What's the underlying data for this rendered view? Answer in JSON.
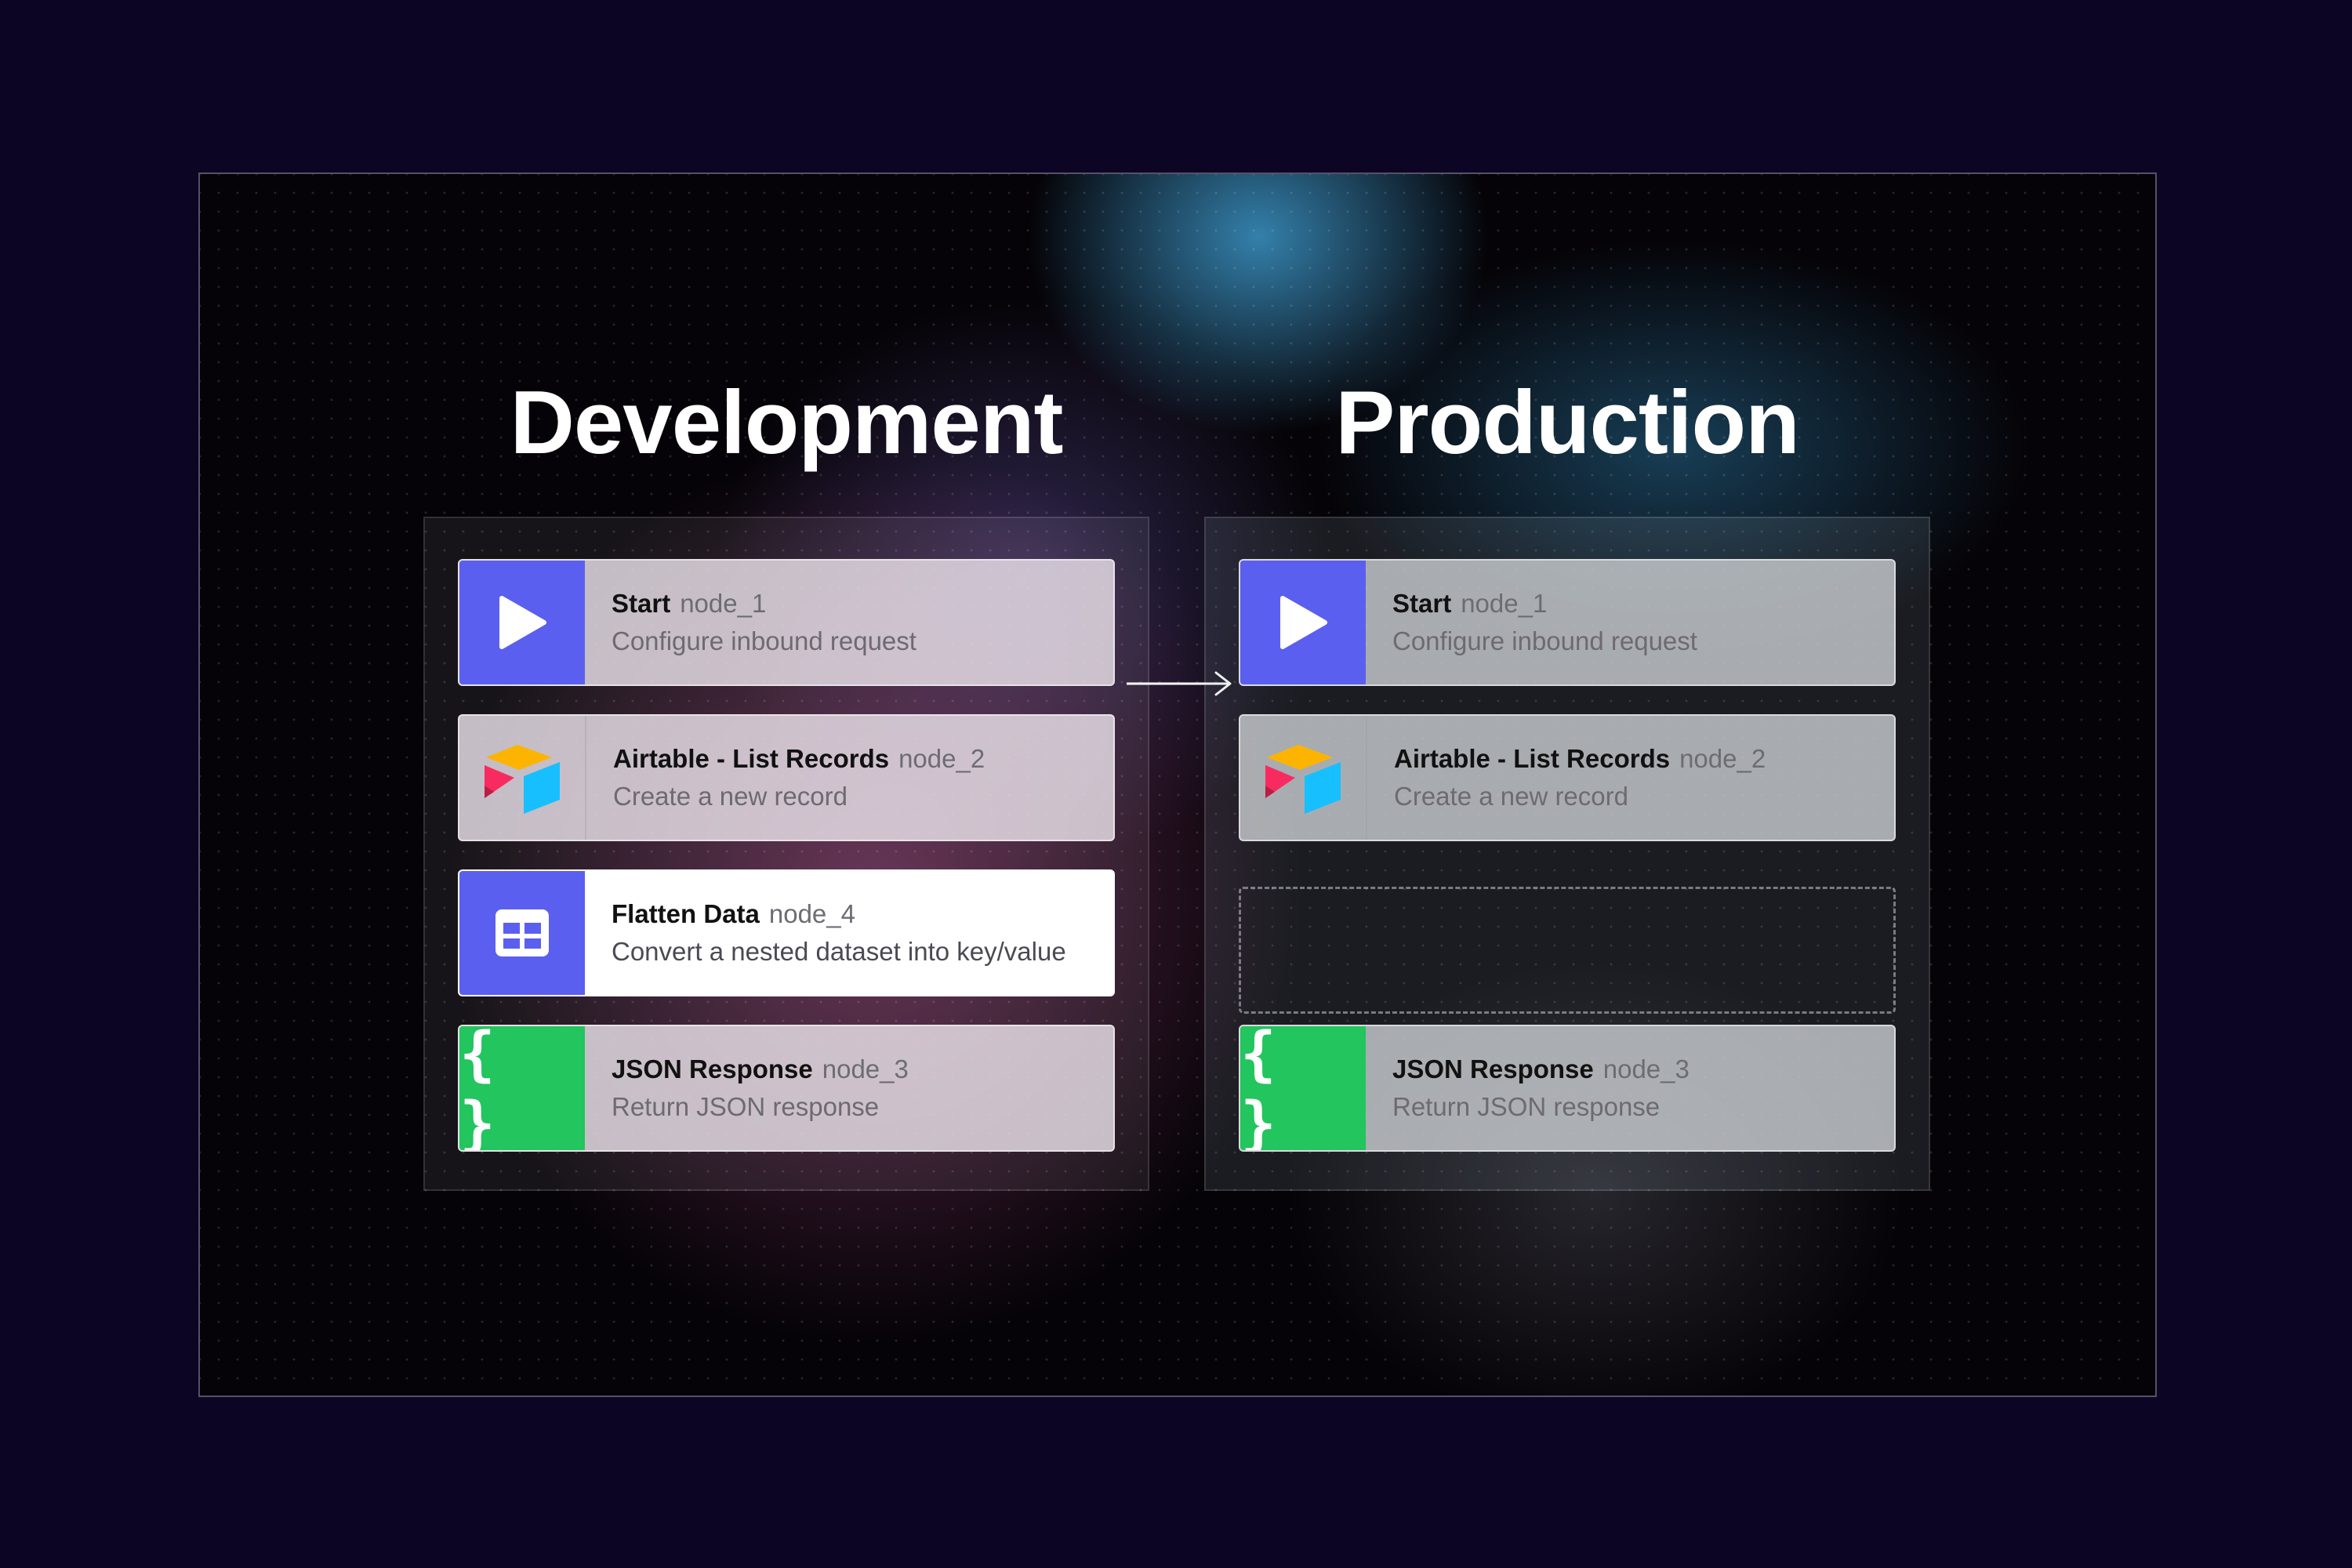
{
  "dev": {
    "heading": "Development",
    "cards": [
      {
        "title": "Start",
        "node": "node_1",
        "subtitle": "Configure inbound request",
        "icon": "play-icon",
        "color": "#5b5fef"
      },
      {
        "title": "Airtable - List Records",
        "node": "node_2",
        "subtitle": "Create a new record",
        "icon": "airtable-logo-icon"
      },
      {
        "title": "Flatten Data",
        "node": "node_4",
        "subtitle": "Convert a nested dataset into key/value",
        "icon": "table-icon",
        "color": "#5b5fef"
      },
      {
        "title": "JSON Response",
        "node": "node_3",
        "subtitle": "Return JSON response",
        "icon": "braces-icon",
        "color": "#22c55e"
      }
    ]
  },
  "prod": {
    "heading": "Production",
    "cards": [
      {
        "title": "Start",
        "node": "node_1",
        "subtitle": "Configure inbound request",
        "icon": "play-icon",
        "color": "#5b5fef"
      },
      {
        "title": "Airtable - List Records",
        "node": "node_2",
        "subtitle": "Create a new record",
        "icon": "airtable-logo-icon"
      },
      {
        "title": "JSON Response",
        "node": "node_3",
        "subtitle": "Return JSON response",
        "icon": "braces-icon",
        "color": "#22c55e"
      }
    ]
  },
  "icons": {
    "braces": "{ }"
  }
}
